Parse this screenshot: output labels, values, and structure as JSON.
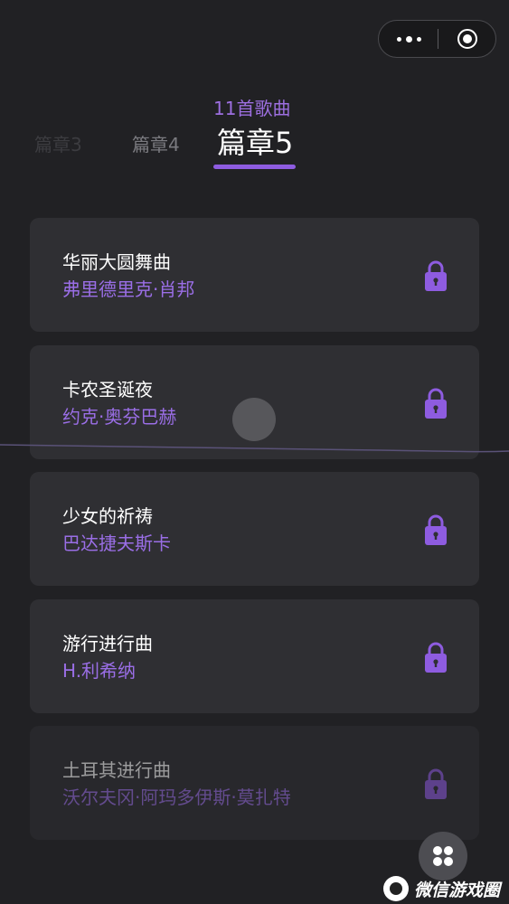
{
  "header": {
    "tabs": [
      {
        "label": "篇章3"
      },
      {
        "label": "篇章4"
      },
      {
        "label": "篇章5"
      }
    ],
    "active_tab_index": 2,
    "song_count": "11首歌曲"
  },
  "songs": [
    {
      "title": "华丽大圆舞曲",
      "composer": "弗里德里克·肖邦",
      "locked": true
    },
    {
      "title": "卡农圣诞夜",
      "composer": "约克·奥芬巴赫",
      "locked": true
    },
    {
      "title": "少女的祈祷",
      "composer": "巴达捷夫斯卡",
      "locked": true
    },
    {
      "title": "游行进行曲",
      "composer": "H.利希纳",
      "locked": true
    },
    {
      "title": "土耳其进行曲",
      "composer": "沃尔夫冈·阿玛多伊斯·莫扎特",
      "locked": true
    }
  ],
  "watermark": {
    "text": "微信游戏圈"
  },
  "icons": {
    "capsule_more": "more-dots-icon",
    "capsule_close": "exit-circle-icon",
    "lock": "lock-icon",
    "grid": "grid-dots-icon"
  },
  "colors": {
    "background": "#212124",
    "card": "#2f2f33",
    "accent": "#9a6ee6",
    "lock": "#8e5ce0"
  }
}
